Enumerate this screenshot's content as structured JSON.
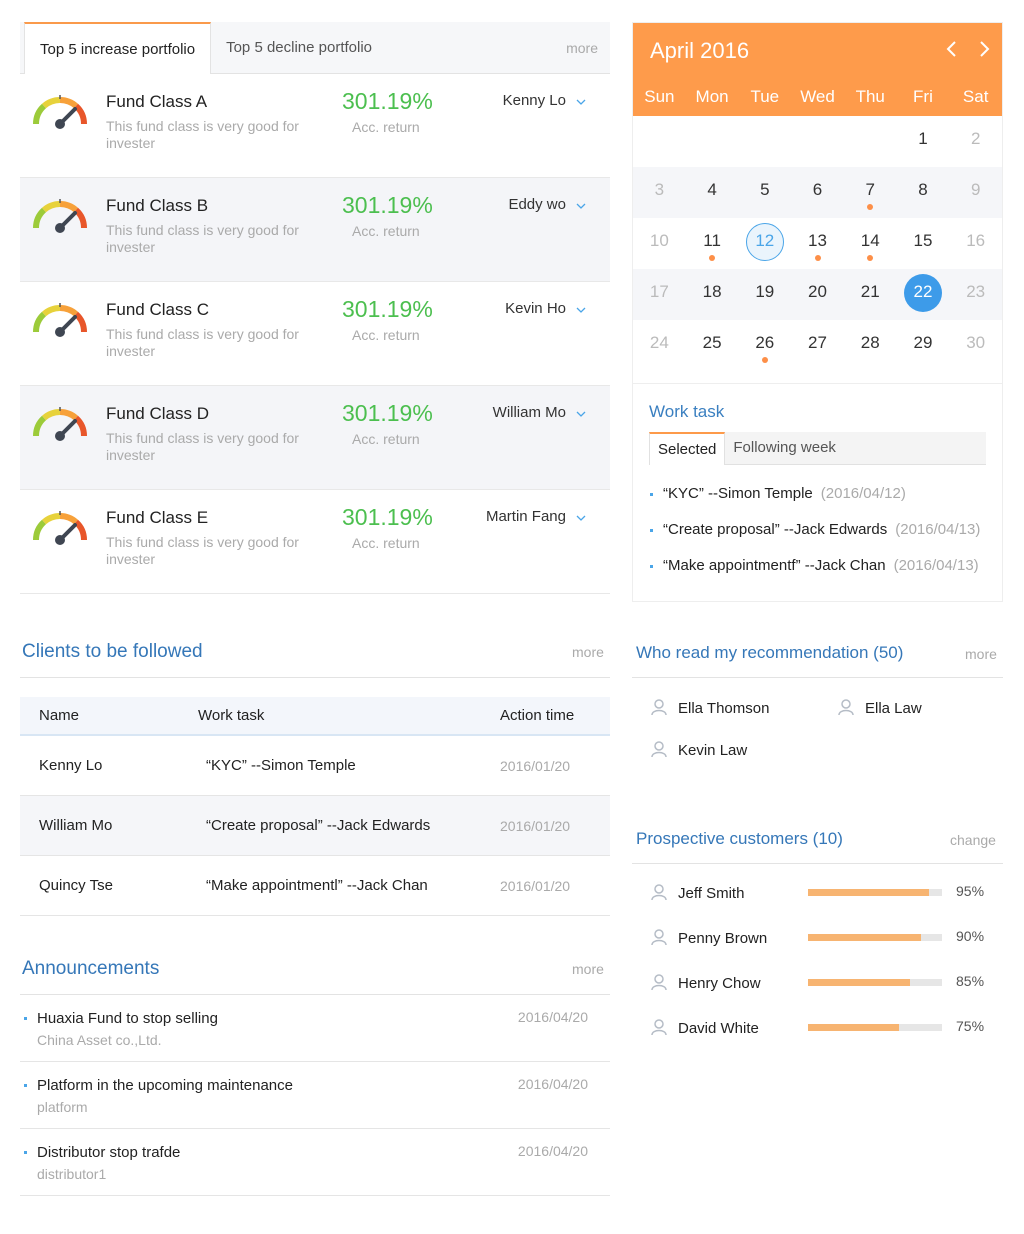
{
  "portfolio": {
    "tabs": [
      "Top 5 increase portfolio",
      "Top 5 decline portfolio"
    ],
    "more": "more",
    "funds": [
      {
        "name": "Fund Class A",
        "desc": "This fund class is very good for invester",
        "return": "301.19%",
        "return_label": "Acc. return",
        "manager": "Kenny Lo"
      },
      {
        "name": "Fund Class B",
        "desc": "This fund class is very good for invester",
        "return": "301.19%",
        "return_label": "Acc. return",
        "manager": "Eddy wo"
      },
      {
        "name": "Fund Class C",
        "desc": "This fund class is very good for invester",
        "return": "301.19%",
        "return_label": "Acc. return",
        "manager": "Kevin Ho"
      },
      {
        "name": "Fund Class D",
        "desc": "This fund class is very good for invester",
        "return": "301.19%",
        "return_label": "Acc. return",
        "manager": "William Mo"
      },
      {
        "name": "Fund Class E",
        "desc": "This fund class is very good for invester",
        "return": "301.19%",
        "return_label": "Acc. return",
        "manager": "Martin Fang"
      }
    ],
    "share_icons": [
      "wechat-icon",
      "whatsapp-icon",
      "line-icon"
    ],
    "colors": {
      "accent": "#fa9a4b",
      "positive": "#4cbf4f"
    }
  },
  "calendar": {
    "title": "April 2016",
    "weekdays": [
      "Sun",
      "Mon",
      "Tue",
      "Wed",
      "Thu",
      "Fri",
      "Sat"
    ],
    "weeks": [
      [
        {
          "d": ""
        },
        {
          "d": ""
        },
        {
          "d": ""
        },
        {
          "d": ""
        },
        {
          "d": ""
        },
        {
          "d": "1"
        },
        {
          "d": "2",
          "muted": true
        }
      ],
      [
        {
          "d": "3",
          "muted": true
        },
        {
          "d": "4"
        },
        {
          "d": "5"
        },
        {
          "d": "6"
        },
        {
          "d": "7",
          "dot": true
        },
        {
          "d": "8"
        },
        {
          "d": "9",
          "muted": true
        }
      ],
      [
        {
          "d": "10",
          "muted": true
        },
        {
          "d": "11",
          "dot": true
        },
        {
          "d": "12",
          "today": true
        },
        {
          "d": "13",
          "dot": true
        },
        {
          "d": "14",
          "dot": true
        },
        {
          "d": "15"
        },
        {
          "d": "16",
          "muted": true
        }
      ],
      [
        {
          "d": "17",
          "muted": true
        },
        {
          "d": "18"
        },
        {
          "d": "19"
        },
        {
          "d": "20"
        },
        {
          "d": "21"
        },
        {
          "d": "22",
          "selected": true
        },
        {
          "d": "23",
          "muted": true
        }
      ],
      [
        {
          "d": "24",
          "muted": true
        },
        {
          "d": "25"
        },
        {
          "d": "26",
          "dot": true
        },
        {
          "d": "27"
        },
        {
          "d": "28"
        },
        {
          "d": "29"
        },
        {
          "d": "30",
          "muted": true
        }
      ]
    ],
    "header_color": "#fe9b4b"
  },
  "work_task": {
    "title": "Work task",
    "tabs": [
      "Selected",
      "Following week"
    ],
    "items": [
      {
        "text": "“KYC”  --Simon Temple",
        "date": "(2016/04/12)"
      },
      {
        "text": "“Create proposal”  --Jack Edwards",
        "date": "(2016/04/13)"
      },
      {
        "text": "“Make appointmentf”  --Jack Chan",
        "date": "(2016/04/13)"
      }
    ]
  },
  "clients": {
    "title": "Clients to be followed",
    "more": "more",
    "headers": [
      "Name",
      "Work task",
      "Action time"
    ],
    "rows": [
      {
        "name": "Kenny Lo",
        "task": "“KYC”  --Simon Temple",
        "time": "2016/01/20"
      },
      {
        "name": "William Mo",
        "task": "“Create proposal”  --Jack Edwards",
        "time": "2016/01/20"
      },
      {
        "name": "Quincy Tse",
        "task": "“Make appointmentl”  --Jack Chan",
        "time": "2016/01/20"
      }
    ]
  },
  "announcements": {
    "title": "Announcements",
    "more": "more",
    "items": [
      {
        "title": "Huaxia Fund to stop selling",
        "source": "China Asset co.,Ltd.",
        "date": "2016/04/20"
      },
      {
        "title": "Platform in the upcoming maintenance",
        "source": "platform",
        "date": "2016/04/20"
      },
      {
        "title": "Distributor stop trafde",
        "source": "distributor1",
        "date": "2016/04/20"
      }
    ]
  },
  "readers": {
    "title": "Who read my recommendation (50)",
    "more": "more",
    "people": [
      "Ella Thomson",
      "Ella Law",
      "Kevin Law"
    ]
  },
  "prospective": {
    "title": "Prospective customers (10)",
    "change": "change",
    "people": [
      {
        "name": "Jeff Smith",
        "percent": "95%",
        "value": 0.9
      },
      {
        "name": "Penny Brown",
        "percent": "90%",
        "value": 0.84
      },
      {
        "name": "Henry Chow",
        "percent": "85%",
        "value": 0.76
      },
      {
        "name": "David White",
        "percent": "75%",
        "value": 0.68
      }
    ],
    "bar_color": "#f7b471"
  }
}
